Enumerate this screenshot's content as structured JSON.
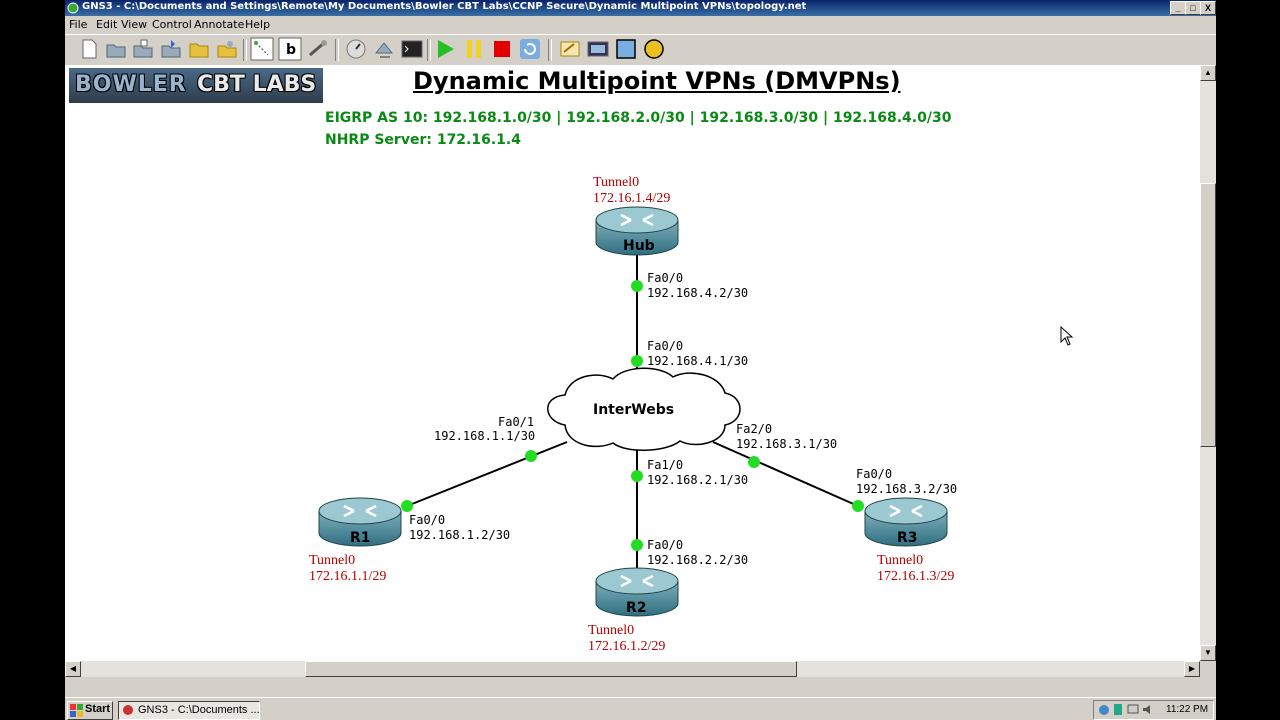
{
  "window": {
    "title": "GNS3 - C:\\Documents and Settings\\Remote\\My Documents\\Bowler CBT Labs\\CCNP Secure\\Dynamic Multipoint VPNs\\topology.net",
    "controls": [
      "_",
      "□",
      "X"
    ]
  },
  "menu": [
    "File",
    "Edit",
    "View",
    "Control",
    "Annotate",
    "Help"
  ],
  "toolbar": {
    "buttons": [
      "new-icon",
      "open-icon",
      "save-icon",
      "save-as-icon",
      "open-folder-icon",
      "snapshot-icon",
      "show-interfaces-icon",
      "hostnames-icon",
      "add-link-icon",
      "preferences-icon",
      "capture-icon",
      "console-icon",
      "start-icon",
      "suspend-icon",
      "stop-icon",
      "reload-icon",
      "note-icon",
      "picture-icon",
      "rectangle-icon",
      "ellipse-icon"
    ]
  },
  "diagram": {
    "logo_left": "BOWLER",
    "logo_right": "CBT LABS",
    "title": "Dynamic Multipoint VPNs (DMVPNs)",
    "eigrp": "EIGRP AS 10: 192.168.1.0/30 | 192.168.2.0/30 | 192.168.3.0/30 | 192.168.4.0/30",
    "nhrp": "NHRP Server: 172.16.1.4",
    "cloud": "InterWebs",
    "routers": {
      "hub": {
        "name": "Hub",
        "tunnel": "Tunnel0",
        "tunnel_ip": "172.16.1.4/29",
        "if": "Fa0/0",
        "ip": "192.168.4.2/30"
      },
      "r1": {
        "name": "R1",
        "tunnel": "Tunnel0",
        "tunnel_ip": "172.16.1.1/29",
        "if": "Fa0/0",
        "ip": "192.168.1.2/30"
      },
      "r2": {
        "name": "R2",
        "tunnel": "Tunnel0",
        "tunnel_ip": "172.16.1.2/29",
        "if": "Fa0/0",
        "ip": "192.168.2.2/30"
      },
      "r3": {
        "name": "R3",
        "tunnel": "Tunnel0",
        "tunnel_ip": "172.16.1.3/29",
        "if": "Fa0/0",
        "ip": "192.168.3.2/30"
      }
    },
    "cloud_ports": {
      "to_hub": {
        "if": "Fa0/0",
        "ip": "192.168.4.1/30"
      },
      "to_r1": {
        "if": "Fa0/1",
        "ip": "192.168.1.1/30"
      },
      "to_r2": {
        "if": "Fa1/0",
        "ip": "192.168.2.1/30"
      },
      "to_r3": {
        "if": "Fa2/0",
        "ip": "192.168.3.1/30"
      }
    },
    "link_status_color": "#22dd22",
    "tunnel_label_color": "#b40000",
    "info_text_color": "#0a8a14"
  },
  "taskbar": {
    "start": "Start",
    "task": "GNS3 - C:\\Documents ...",
    "clock": "11:22 PM"
  }
}
